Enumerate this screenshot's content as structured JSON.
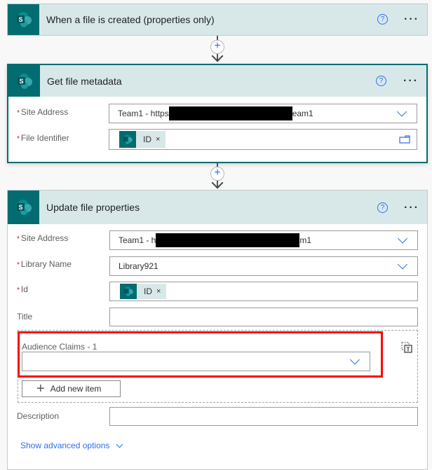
{
  "trigger": {
    "title": "When a file is created (properties only)",
    "icon": "sharepoint-icon"
  },
  "connector_icon": "plus-icon",
  "get_metadata": {
    "title": "Get file metadata",
    "fields": {
      "site_address": {
        "label": "Site Address",
        "required": "*",
        "value_prefix": "Team1 - https",
        "value_suffix": "eam1"
      },
      "file_identifier": {
        "label": "File Identifier",
        "required": "*",
        "token": "ID",
        "token_remove": "×"
      }
    }
  },
  "update_props": {
    "title": "Update file properties",
    "fields": {
      "site_address": {
        "label": "Site Address",
        "required": "*",
        "value_prefix": "Team1 - h",
        "value_suffix": "m1"
      },
      "library_name": {
        "label": "Library Name",
        "required": "*",
        "value": "Library921"
      },
      "id": {
        "label": "Id",
        "required": "*",
        "token": "ID",
        "token_remove": "×"
      },
      "title": {
        "label": "Title",
        "value": ""
      },
      "audience_claims": {
        "label": "Audience Claims - 1",
        "value": ""
      },
      "add_new_item": "Add new item",
      "description": {
        "label": "Description",
        "value": ""
      }
    },
    "show_advanced": "Show advanced options"
  },
  "colors": {
    "brand_teal": "#036c70",
    "header_bg": "#d8e8e9",
    "accent_blue": "#2f6ff0",
    "highlight_red": "#ff0000"
  }
}
